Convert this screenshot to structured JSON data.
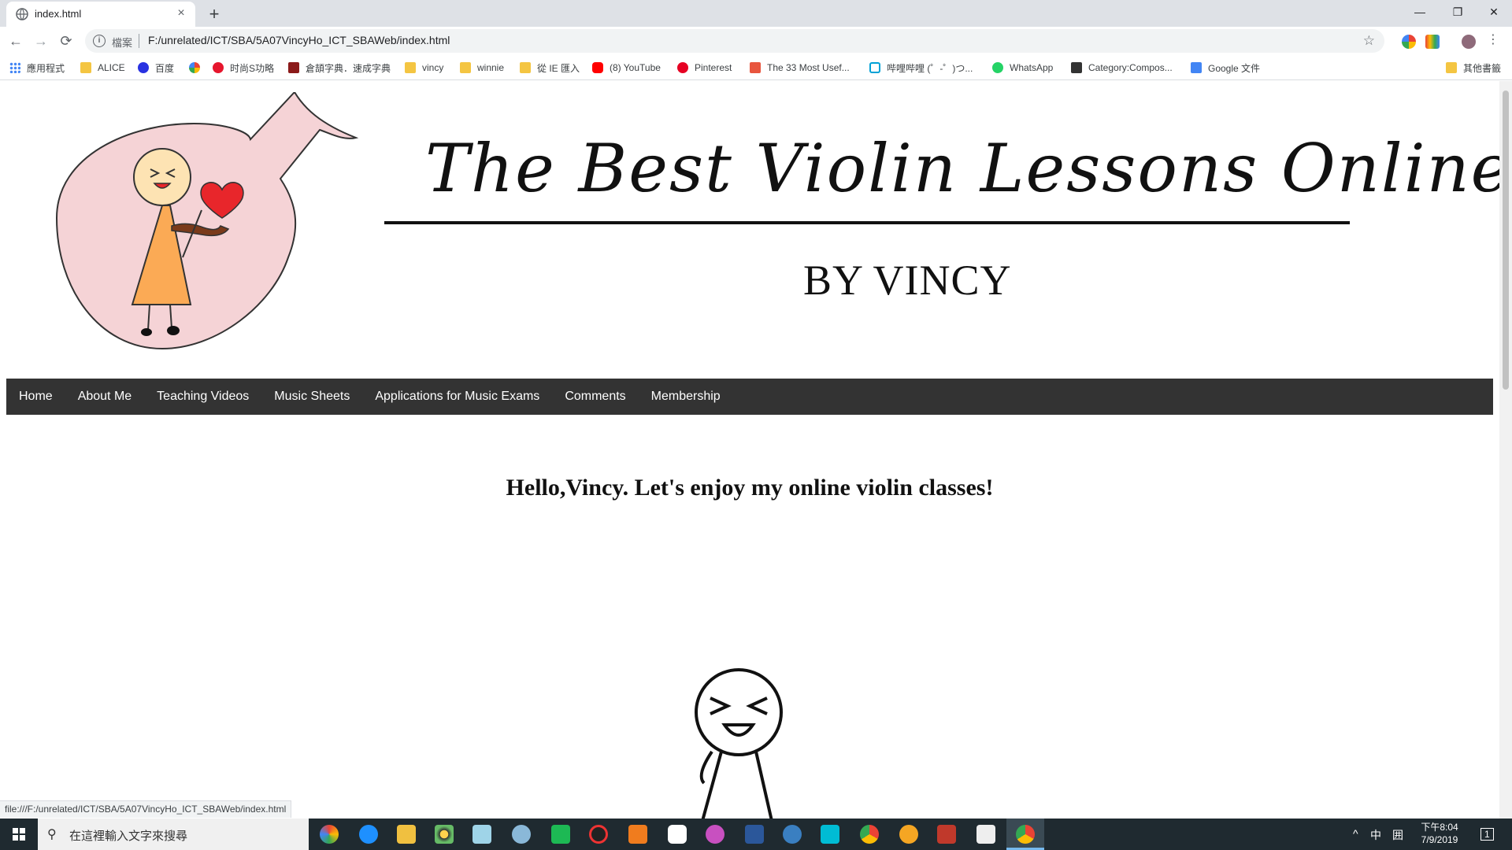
{
  "browser": {
    "tab_title": "index.html",
    "tab_close": "×",
    "new_tab": "+",
    "window_controls": {
      "minimize": "—",
      "restore": "❐",
      "close": "✕"
    },
    "nav": {
      "back": "←",
      "forward": "→",
      "reload": "⟳"
    },
    "address": {
      "info_glyph": "i",
      "scheme_label": "檔案",
      "url": "F:/unrelated/ICT/SBA/5A07VincyHo_ICT_SBAWeb/index.html",
      "star": "☆"
    },
    "bookmarks": [
      {
        "label": "應用程式",
        "icon": "apps-icon",
        "color": "#4285f4"
      },
      {
        "label": "ALICE",
        "icon": "folder-icon",
        "color": "#f4c542"
      },
      {
        "label": "百度",
        "icon": "baidu-icon",
        "color": "#2932e1"
      },
      {
        "label": "",
        "icon": "google-icon",
        "color": "#ea4335"
      },
      {
        "label": "时尚S功略",
        "icon": "weibo-icon",
        "color": "#e6162d"
      },
      {
        "label": "倉頡字典．速成字典",
        "icon": "dictionary-icon",
        "color": "#8b1a1a"
      },
      {
        "label": "vincy",
        "icon": "folder-icon",
        "color": "#f4c542"
      },
      {
        "label": "winnie",
        "icon": "folder-icon",
        "color": "#f4c542"
      },
      {
        "label": "從 IE 匯入",
        "icon": "folder-icon",
        "color": "#f4c542"
      },
      {
        "label": "(8) YouTube",
        "icon": "youtube-icon",
        "color": "#ff0000"
      },
      {
        "label": "Pinterest",
        "icon": "pinterest-icon",
        "color": "#e60023"
      },
      {
        "label": "The 33 Most Usef...",
        "icon": "bookmark-icon",
        "color": "#e8553e"
      },
      {
        "label": "哔哩哔哩 (゜-゜)つ...",
        "icon": "bilibili-icon",
        "color": "#00a1d6"
      },
      {
        "label": "WhatsApp",
        "icon": "whatsapp-icon",
        "color": "#25d366"
      },
      {
        "label": "Category:Compos...",
        "icon": "wiki-icon",
        "color": "#333333"
      },
      {
        "label": "Google 文件",
        "icon": "google-docs-icon",
        "color": "#4285f4"
      }
    ],
    "other_bookmarks": "其他書籤",
    "status_url": "file:///F:/unrelated/ICT/SBA/5A07VincyHo_ICT_SBAWeb/index.html"
  },
  "site": {
    "title": "The Best Violin Lessons Online",
    "subtitle": "BY VINCY",
    "nav": [
      "Home",
      "About Me",
      "Teaching Videos",
      "Music Sheets",
      "Applications for Music Exams",
      "Comments",
      "Membership"
    ],
    "greeting": "Hello,Vincy. Let's enjoy my online violin classes!",
    "colors": {
      "nav_bg": "#333333",
      "speech_bubble": "#f5d3d6",
      "dress": "#fbaa55",
      "heart": "#e8262b"
    }
  },
  "taskbar": {
    "search_placeholder": "在這裡輸入文字來搜尋",
    "ime_lang": "中",
    "ime_mode": "囲",
    "time": "下午8:04",
    "date": "7/9/2019",
    "notification_count": "1"
  }
}
